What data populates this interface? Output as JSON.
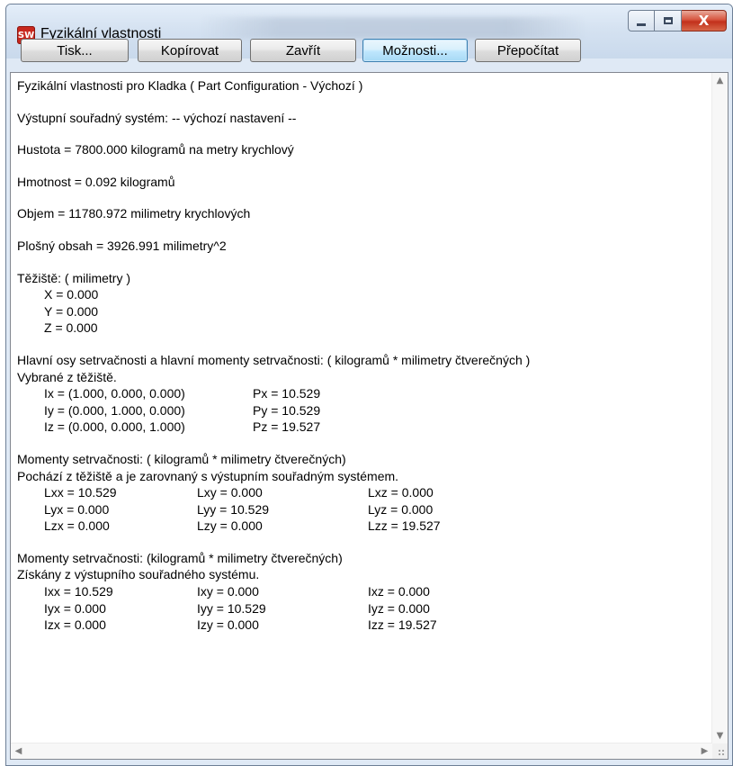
{
  "window": {
    "title": "Fyzikální vlastnosti",
    "app_icon_text": "SW",
    "close_glyph": "X"
  },
  "toolbar": {
    "print_label": "Tisk...",
    "copy_label": "Kopírovat",
    "close_label": "Zavřít",
    "options_label": "Možnosti...",
    "recalc_label": "Přepočítat"
  },
  "report": {
    "header": "Fyzikální vlastnosti pro Kladka ( Part Configuration - Výchozí )",
    "coord_system": "Výstupní souřadný systém: -- výchozí nastavení --",
    "density": "Hustota = 7800.000 kilogramů na metry krychlový",
    "mass": "Hmotnost = 0.092 kilogramů",
    "volume": "Objem = 11780.972 milimetry krychlových",
    "surface_area": "Plošný obsah = 3926.991 milimetry^2",
    "center_of_mass": {
      "title": "Těžiště: ( milimetry )",
      "x": "X = 0.000",
      "y": "Y = 0.000",
      "z": "Z = 0.000"
    },
    "principal": {
      "title": "Hlavní osy setrvačnosti a hlavní momenty setrvačnosti: ( kilogramů * milimetry čtverečných )",
      "subtitle": "Vybrané z těžiště.",
      "rows": [
        {
          "axis": "Ix = (1.000, 0.000, 0.000)",
          "moment": "Px = 10.529"
        },
        {
          "axis": "Iy = (0.000, 1.000, 0.000)",
          "moment": "Py = 10.529"
        },
        {
          "axis": "Iz = (0.000, 0.000, 1.000)",
          "moment": "Pz = 19.527"
        }
      ]
    },
    "moments_cm": {
      "title": "Momenty setrvačnosti: ( kilogramů * milimetry čtverečných)",
      "subtitle": "Pochází z těžiště a je zarovnaný s výstupním souřadným systémem.",
      "rows": [
        [
          "Lxx = 10.529",
          "Lxy = 0.000",
          "Lxz = 0.000"
        ],
        [
          "Lyx = 0.000",
          "Lyy = 10.529",
          "Lyz = 0.000"
        ],
        [
          "Lzx = 0.000",
          "Lzy = 0.000",
          "Lzz = 19.527"
        ]
      ]
    },
    "moments_out": {
      "title": "Momenty setrvačnosti: (kilogramů * milimetry čtverečných)",
      "subtitle": "Získány z výstupního souřadného systému.",
      "rows": [
        [
          "Ixx = 10.529",
          "Ixy = 0.000",
          "Ixz = 0.000"
        ],
        [
          "Iyx = 0.000",
          "Iyy = 10.529",
          "Iyz = 0.000"
        ],
        [
          "Izx = 0.000",
          "Izy = 0.000",
          "Izz = 19.527"
        ]
      ]
    }
  },
  "colors": {
    "titlebar": "#d5e2f1",
    "close_button": "#c2301b",
    "focused_button": "#bee6fd"
  }
}
